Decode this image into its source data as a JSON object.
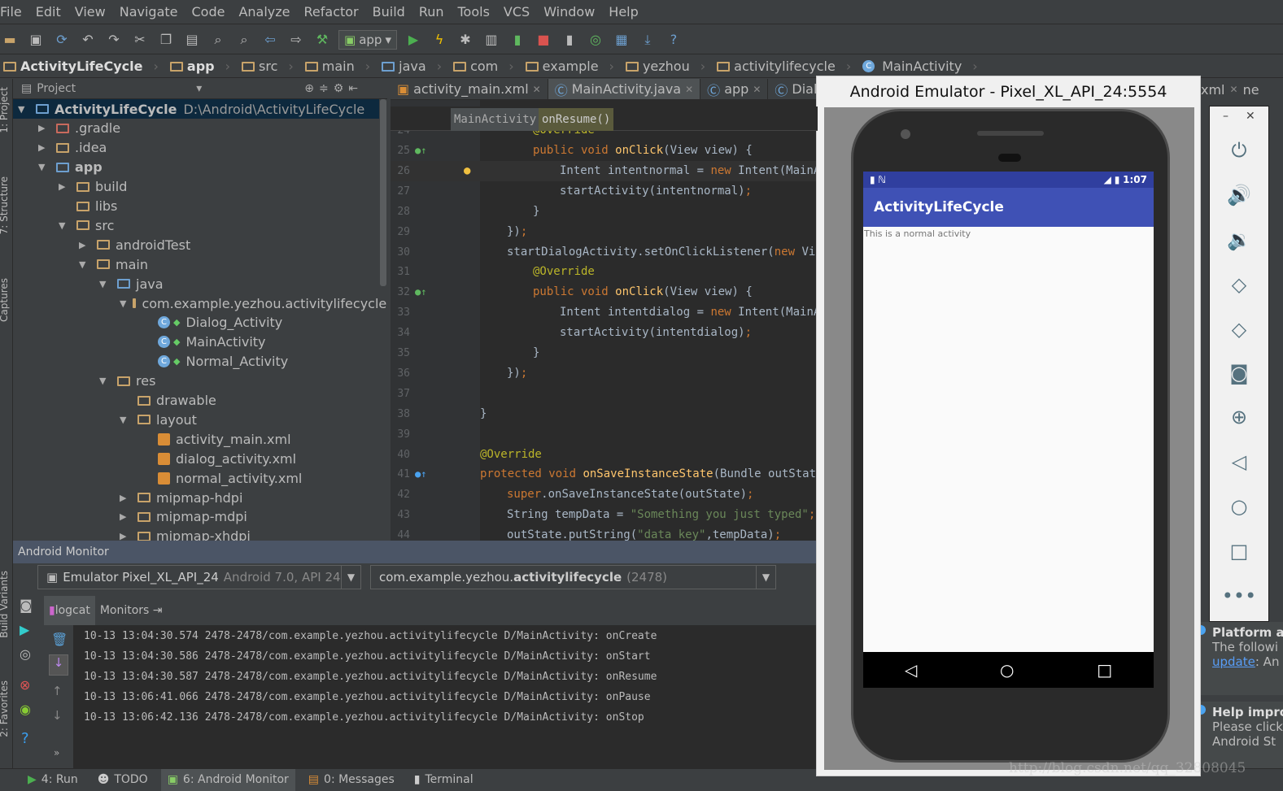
{
  "menu": [
    "File",
    "Edit",
    "View",
    "Navigate",
    "Code",
    "Analyze",
    "Refactor",
    "Build",
    "Run",
    "Tools",
    "VCS",
    "Window",
    "Help"
  ],
  "toolbar": {
    "run_config": "app"
  },
  "breadcrumb": [
    "ActivityLifeCycle",
    "app",
    "src",
    "main",
    "java",
    "com",
    "example",
    "yezhou",
    "activitylifecycle",
    "MainActivity"
  ],
  "left_strip": {
    "project": "1: Project",
    "structure": "7: Structure",
    "captures": "Captures",
    "build_variants": "Build Variants",
    "favorites": "2: Favorites"
  },
  "project": {
    "view": "Project",
    "tree": [
      {
        "label": "ActivityLifeCycle",
        "path": "D:\\Android\\ActivityLifeCycle",
        "level": 0,
        "expanded": true,
        "type": "module",
        "selected": true
      },
      {
        "label": ".gradle",
        "level": 1,
        "expanded": false,
        "type": "folder"
      },
      {
        "label": ".idea",
        "level": 1,
        "expanded": false,
        "type": "folder"
      },
      {
        "label": "app",
        "level": 1,
        "expanded": true,
        "type": "module"
      },
      {
        "label": "build",
        "level": 2,
        "expanded": false,
        "type": "folder"
      },
      {
        "label": "libs",
        "level": 2,
        "type": "folder"
      },
      {
        "label": "src",
        "level": 2,
        "expanded": true,
        "type": "folder"
      },
      {
        "label": "androidTest",
        "level": 3,
        "expanded": false,
        "type": "folder"
      },
      {
        "label": "main",
        "level": 3,
        "expanded": true,
        "type": "folder"
      },
      {
        "label": "java",
        "level": 4,
        "expanded": true,
        "type": "source"
      },
      {
        "label": "com.example.yezhou.activitylifecycle",
        "level": 5,
        "expanded": true,
        "type": "package"
      },
      {
        "label": "Dialog_Activity",
        "level": 6,
        "type": "class"
      },
      {
        "label": "MainActivity",
        "level": 6,
        "type": "class"
      },
      {
        "label": "Normal_Activity",
        "level": 6,
        "type": "class"
      },
      {
        "label": "res",
        "level": 4,
        "expanded": true,
        "type": "res"
      },
      {
        "label": "drawable",
        "level": 5,
        "type": "folder"
      },
      {
        "label": "layout",
        "level": 5,
        "expanded": true,
        "type": "folder"
      },
      {
        "label": "activity_main.xml",
        "level": 6,
        "type": "xml"
      },
      {
        "label": "dialog_activity.xml",
        "level": 6,
        "type": "xml"
      },
      {
        "label": "normal_activity.xml",
        "level": 6,
        "type": "xml"
      },
      {
        "label": "mipmap-hdpi",
        "level": 5,
        "expanded": false,
        "type": "folder"
      },
      {
        "label": "mipmap-mdpi",
        "level": 5,
        "expanded": false,
        "type": "folder"
      },
      {
        "label": "mipmap-xhdpi",
        "level": 5,
        "expanded": false,
        "type": "folder"
      }
    ]
  },
  "editor": {
    "tabs": [
      "activity_main.xml",
      "MainActivity.java",
      "app",
      "Dialog"
    ],
    "active_tab": 1,
    "crumbs": [
      "MainActivity",
      "onResume()"
    ],
    "lines": [
      {
        "n": "24",
        "indent": 2,
        "t": [
          [
            "@Override",
            "an"
          ]
        ]
      },
      {
        "n": "25",
        "indent": 2,
        "t": [
          [
            "public void ",
            "kw"
          ],
          [
            "onClick",
            "fn"
          ],
          [
            "(View view) {",
            "pl"
          ]
        ]
      },
      {
        "n": "26",
        "indent": 3,
        "t": [
          [
            "Intent intentnormal = ",
            "pl"
          ],
          [
            "new ",
            "kw"
          ],
          [
            "Intent(MainAct",
            "pl"
          ]
        ]
      },
      {
        "n": "27",
        "indent": 3,
        "t": [
          [
            "startActivity(intentnormal)",
            "pl"
          ],
          [
            ";",
            "sm"
          ]
        ]
      },
      {
        "n": "28",
        "indent": 2,
        "t": [
          [
            "}",
            "pl"
          ]
        ]
      },
      {
        "n": "29",
        "indent": 1,
        "t": [
          [
            "})",
            "pl"
          ],
          [
            ";",
            "sm"
          ]
        ]
      },
      {
        "n": "30",
        "indent": 1,
        "t": [
          [
            "startDialogActivity.setOnClickListener(",
            "pl"
          ],
          [
            "new ",
            "kw"
          ],
          [
            "View.",
            "pl"
          ]
        ]
      },
      {
        "n": "31",
        "indent": 2,
        "t": [
          [
            "@Override",
            "an"
          ]
        ]
      },
      {
        "n": "32",
        "indent": 2,
        "t": [
          [
            "public void ",
            "kw"
          ],
          [
            "onClick",
            "fn"
          ],
          [
            "(View view) {",
            "pl"
          ]
        ]
      },
      {
        "n": "33",
        "indent": 3,
        "t": [
          [
            "Intent intentdialog = ",
            "pl"
          ],
          [
            "new ",
            "kw"
          ],
          [
            "Intent(MainAct",
            "pl"
          ]
        ]
      },
      {
        "n": "34",
        "indent": 3,
        "t": [
          [
            "startActivity(intentdialog)",
            "pl"
          ],
          [
            ";",
            "sm"
          ]
        ]
      },
      {
        "n": "35",
        "indent": 2,
        "t": [
          [
            "}",
            "pl"
          ]
        ]
      },
      {
        "n": "36",
        "indent": 1,
        "t": [
          [
            "})",
            "pl"
          ],
          [
            ";",
            "sm"
          ]
        ]
      },
      {
        "n": "37",
        "indent": 0,
        "t": []
      },
      {
        "n": "38",
        "indent": 0,
        "t": [
          [
            "}",
            "pl"
          ]
        ]
      },
      {
        "n": "39",
        "indent": 0,
        "t": []
      },
      {
        "n": "40",
        "indent": 0,
        "t": [
          [
            "@Override",
            "an"
          ]
        ]
      },
      {
        "n": "41",
        "indent": 0,
        "t": [
          [
            "protected void ",
            "kw"
          ],
          [
            "onSaveInstanceState",
            "fn"
          ],
          [
            "(Bundle outState)",
            "pl"
          ]
        ]
      },
      {
        "n": "42",
        "indent": 1,
        "t": [
          [
            "super",
            "kw"
          ],
          [
            ".onSaveInstanceState(outState)",
            "pl"
          ],
          [
            ";",
            "sm"
          ]
        ]
      },
      {
        "n": "43",
        "indent": 1,
        "t": [
          [
            "String tempData = ",
            "pl"
          ],
          [
            "\"Something you just typed\"",
            "st"
          ],
          [
            ";",
            "sm"
          ]
        ]
      },
      {
        "n": "44",
        "indent": 1,
        "t": [
          [
            "outState.putString(",
            "pl"
          ],
          [
            "\"data_key\"",
            "st"
          ],
          [
            ",tempData)",
            "pl"
          ],
          [
            ";",
            "sm"
          ]
        ]
      }
    ]
  },
  "monitor": {
    "title": "Android Monitor",
    "device": "Emulator Pixel_XL_API_24",
    "device_detail": "Android 7.0, API 24",
    "process_prefix": "com.example.yezhou.",
    "process_bold": "activitylifecycle",
    "process_pid": "(2478)",
    "tabs": [
      "logcat",
      "Monitors"
    ],
    "log": [
      "10-13 13:04:30.574 2478-2478/com.example.yezhou.activitylifecycle D/MainActivity: onCreate",
      "10-13 13:04:30.586 2478-2478/com.example.yezhou.activitylifecycle D/MainActivity: onStart",
      "10-13 13:04:30.587 2478-2478/com.example.yezhou.activitylifecycle D/MainActivity: onResume",
      "10-13 13:06:41.066 2478-2478/com.example.yezhou.activitylifecycle D/MainActivity: onPause",
      "10-13 13:06:42.136 2478-2478/com.example.yezhou.activitylifecycle D/MainActivity: onStop"
    ]
  },
  "statusbar": [
    "4: Run",
    "TODO",
    "6: Android Monitor",
    "0: Messages",
    "Terminal"
  ],
  "emulator": {
    "title": "Android Emulator - Pixel_XL_API_24:5554",
    "time": "1:07",
    "app_title": "ActivityLifeCycle",
    "content": "This is a normal activity",
    "side_controls": [
      "power",
      "volume-up",
      "volume-down",
      "rotate-left",
      "rotate-right",
      "screenshot",
      "zoom",
      "back",
      "home",
      "overview",
      "more"
    ]
  },
  "right_panel": {
    "tabs": [
      "xml",
      "ne"
    ],
    "notif1_title": "Platform a",
    "notif1_text": "The followi",
    "notif1_link": "update",
    "notif1_rest": ": An",
    "notif2_title": "Help impro",
    "notif2_line1": "Please click",
    "notif2_line2": "Android St"
  },
  "watermark": "http://blog.csdn.net/qq_32808045",
  "colors": {
    "accent": "#3f51b5",
    "status_bar": "#303f9f",
    "editor_bg": "#2b2b2b",
    "ide_bg": "#3c3f41",
    "selection": "#0d293e"
  }
}
